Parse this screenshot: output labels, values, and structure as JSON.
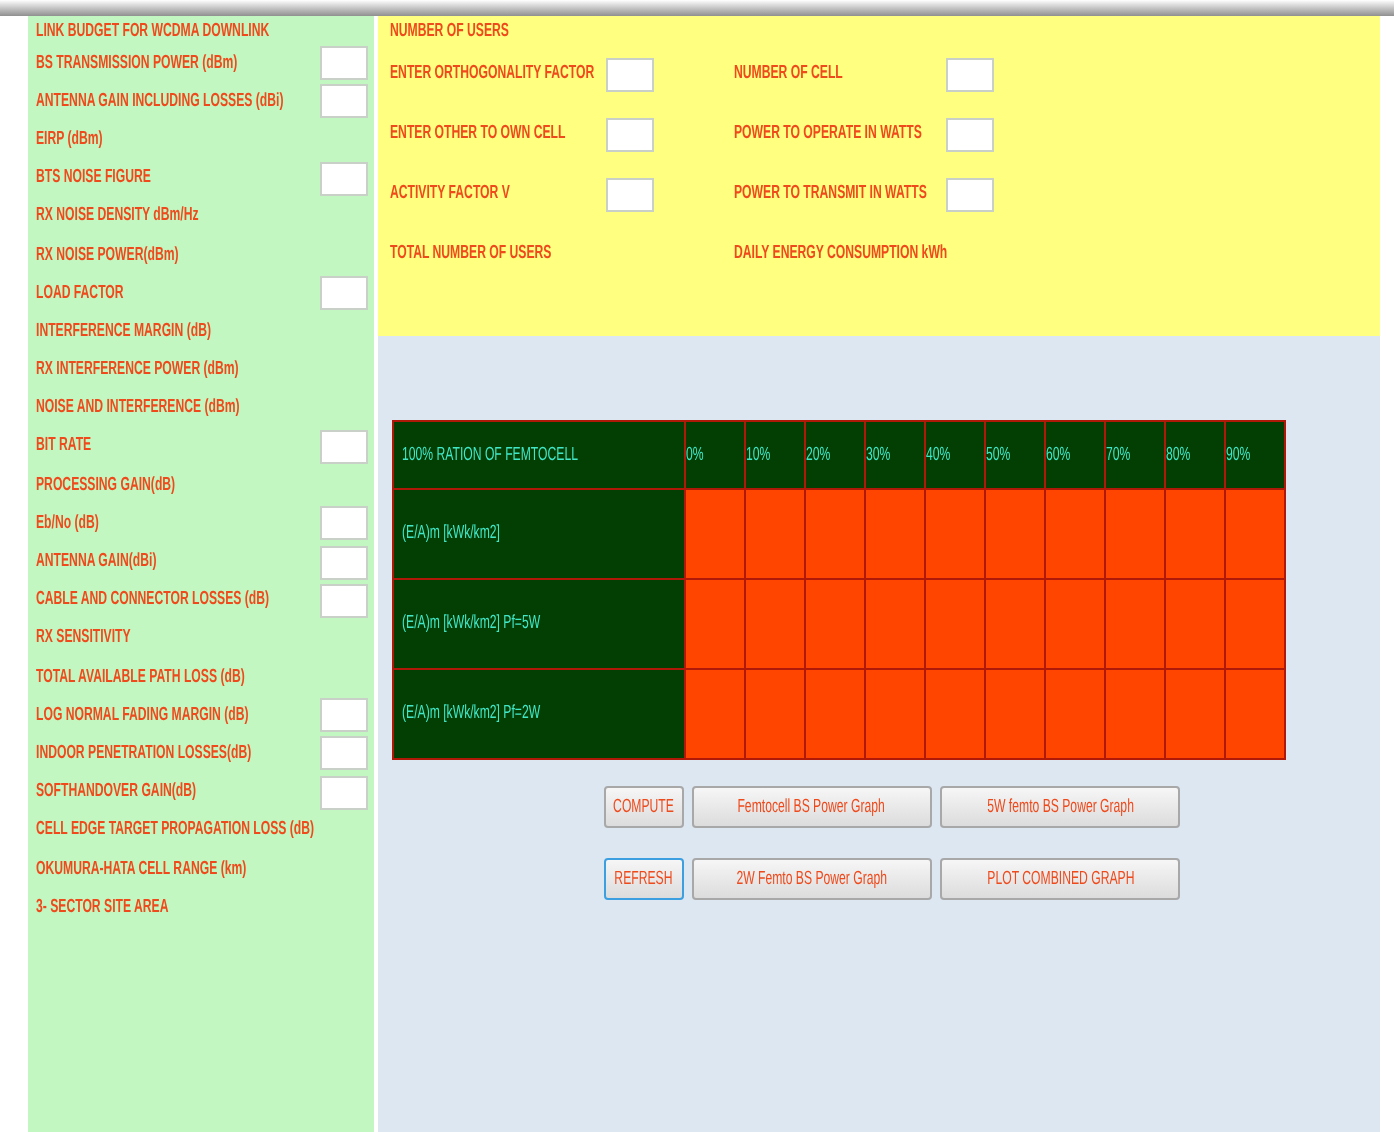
{
  "link_budget": {
    "title": "LINK BUDGET FOR WCDMA DOWNLINK",
    "rows": [
      {
        "label": "BS TRANSMISSION POWER (dBm)",
        "kind": "input"
      },
      {
        "label": "ANTENNA GAIN INCLUDING LOSSES (dBi)",
        "kind": "input"
      },
      {
        "label": "EIRP (dBm)",
        "kind": "output"
      },
      {
        "label": "BTS NOISE FIGURE",
        "kind": "input"
      },
      {
        "label": "RX NOISE DENSITY dBm/Hz",
        "kind": "output"
      },
      {
        "label": "RX NOISE POWER(dBm)",
        "kind": "output"
      },
      {
        "label": "LOAD FACTOR",
        "kind": "input"
      },
      {
        "label": "INTERFERENCE MARGIN (dB)",
        "kind": "output"
      },
      {
        "label": "RX INTERFERENCE POWER (dBm)",
        "kind": "output"
      },
      {
        "label": "NOISE AND INTERFERENCE (dBm)",
        "kind": "output"
      },
      {
        "label": "BIT RATE",
        "kind": "input"
      },
      {
        "label": "PROCESSING GAIN(dB)",
        "kind": "output"
      },
      {
        "label": "Eb/No (dB)",
        "kind": "input"
      },
      {
        "label": "ANTENNA GAIN(dBi)",
        "kind": "input"
      },
      {
        "label": "CABLE AND CONNECTOR LOSSES (dB)",
        "kind": "input"
      },
      {
        "label": "RX  SENSITIVITY",
        "kind": "output"
      },
      {
        "label": "TOTAL AVAILABLE PATH LOSS (dB)",
        "kind": "output"
      },
      {
        "label": "LOG NORMAL FADING MARGIN (dB)",
        "kind": "input"
      },
      {
        "label": "INDOOR PENETRATION LOSSES(dB)",
        "kind": "input"
      },
      {
        "label": "SOFTHANDOVER GAIN(dB)",
        "kind": "input"
      },
      {
        "label": "CELL EDGE TARGET PROPAGATION LOSS (dB)",
        "kind": "output"
      },
      {
        "label": "OKUMURA-HATA CELL RANGE (km)",
        "kind": "output"
      },
      {
        "label": "3- SECTOR SITE AREA",
        "kind": "output"
      }
    ]
  },
  "users": {
    "title": "NUMBER OF USERS",
    "columns": [
      [
        {
          "label": "ENTER ORTHOGONALITY FACTOR",
          "kind": "input"
        },
        {
          "label": "ENTER OTHER TO OWN CELL",
          "kind": "input"
        },
        {
          "label": "ACTIVITY FACTOR V",
          "kind": "input"
        },
        {
          "label": "TOTAL NUMBER OF USERS",
          "kind": "output"
        }
      ],
      [
        {
          "label": "NUMBER OF CELL",
          "kind": "input"
        },
        {
          "label": "POWER TO OPERATE IN WATTS",
          "kind": "input"
        },
        {
          "label": "POWER TO TRANSMIT IN WATTS",
          "kind": "input"
        },
        {
          "label": "DAILY ENERGY CONSUMPTION kWh",
          "kind": "output"
        }
      ]
    ]
  },
  "table": {
    "corner": "100%  RATION OF FEMTOCELL",
    "columns": [
      "0%",
      "10%",
      "20%",
      "30%",
      "40%",
      "50%",
      "60%",
      "70%",
      "80%",
      "90%"
    ],
    "rows": [
      "(E/A)m [kWk/km2]",
      "(E/A)m [kWk/km2] Pf=5W",
      "(E/A)m [kWk/km2] Pf=2W"
    ]
  },
  "buttons": [
    [
      {
        "label": "COMPUTE",
        "focused": false
      },
      {
        "label": "Femtocell BS Power Graph",
        "focused": false
      },
      {
        "label": "5W femto BS Power Graph",
        "focused": false
      }
    ],
    [
      {
        "label": "REFRESH",
        "focused": true
      },
      {
        "label": "2W Femto BS Power Graph",
        "focused": false
      },
      {
        "label": "PLOT COMBINED GRAPH",
        "focused": false
      }
    ]
  ]
}
